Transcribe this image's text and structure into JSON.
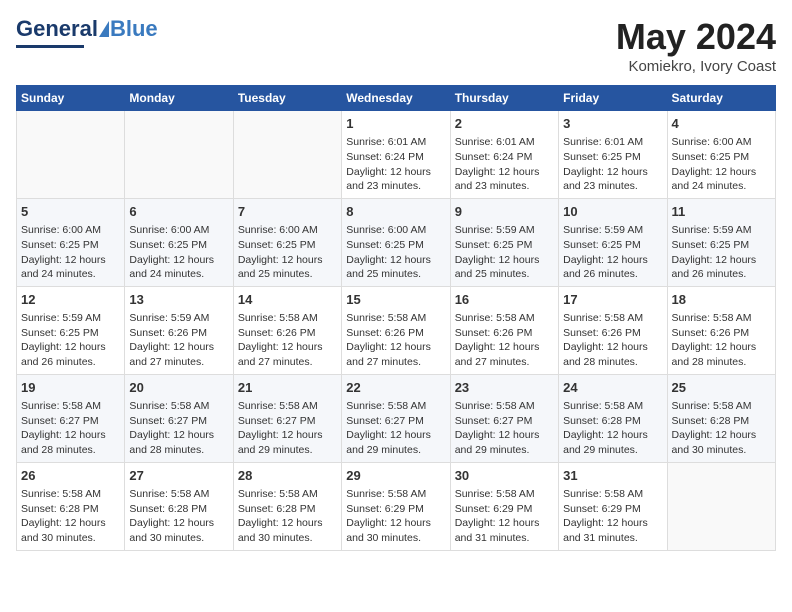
{
  "header": {
    "logo_general": "General",
    "logo_blue": "Blue",
    "title": "May 2024",
    "location": "Komiekro, Ivory Coast"
  },
  "days_of_week": [
    "Sunday",
    "Monday",
    "Tuesday",
    "Wednesday",
    "Thursday",
    "Friday",
    "Saturday"
  ],
  "weeks": [
    [
      {
        "day": "",
        "sunrise": "",
        "sunset": "",
        "daylight": ""
      },
      {
        "day": "",
        "sunrise": "",
        "sunset": "",
        "daylight": ""
      },
      {
        "day": "",
        "sunrise": "",
        "sunset": "",
        "daylight": ""
      },
      {
        "day": "1",
        "sunrise": "Sunrise: 6:01 AM",
        "sunset": "Sunset: 6:24 PM",
        "daylight": "Daylight: 12 hours and 23 minutes."
      },
      {
        "day": "2",
        "sunrise": "Sunrise: 6:01 AM",
        "sunset": "Sunset: 6:24 PM",
        "daylight": "Daylight: 12 hours and 23 minutes."
      },
      {
        "day": "3",
        "sunrise": "Sunrise: 6:01 AM",
        "sunset": "Sunset: 6:25 PM",
        "daylight": "Daylight: 12 hours and 23 minutes."
      },
      {
        "day": "4",
        "sunrise": "Sunrise: 6:00 AM",
        "sunset": "Sunset: 6:25 PM",
        "daylight": "Daylight: 12 hours and 24 minutes."
      }
    ],
    [
      {
        "day": "5",
        "sunrise": "Sunrise: 6:00 AM",
        "sunset": "Sunset: 6:25 PM",
        "daylight": "Daylight: 12 hours and 24 minutes."
      },
      {
        "day": "6",
        "sunrise": "Sunrise: 6:00 AM",
        "sunset": "Sunset: 6:25 PM",
        "daylight": "Daylight: 12 hours and 24 minutes."
      },
      {
        "day": "7",
        "sunrise": "Sunrise: 6:00 AM",
        "sunset": "Sunset: 6:25 PM",
        "daylight": "Daylight: 12 hours and 25 minutes."
      },
      {
        "day": "8",
        "sunrise": "Sunrise: 6:00 AM",
        "sunset": "Sunset: 6:25 PM",
        "daylight": "Daylight: 12 hours and 25 minutes."
      },
      {
        "day": "9",
        "sunrise": "Sunrise: 5:59 AM",
        "sunset": "Sunset: 6:25 PM",
        "daylight": "Daylight: 12 hours and 25 minutes."
      },
      {
        "day": "10",
        "sunrise": "Sunrise: 5:59 AM",
        "sunset": "Sunset: 6:25 PM",
        "daylight": "Daylight: 12 hours and 26 minutes."
      },
      {
        "day": "11",
        "sunrise": "Sunrise: 5:59 AM",
        "sunset": "Sunset: 6:25 PM",
        "daylight": "Daylight: 12 hours and 26 minutes."
      }
    ],
    [
      {
        "day": "12",
        "sunrise": "Sunrise: 5:59 AM",
        "sunset": "Sunset: 6:25 PM",
        "daylight": "Daylight: 12 hours and 26 minutes."
      },
      {
        "day": "13",
        "sunrise": "Sunrise: 5:59 AM",
        "sunset": "Sunset: 6:26 PM",
        "daylight": "Daylight: 12 hours and 27 minutes."
      },
      {
        "day": "14",
        "sunrise": "Sunrise: 5:58 AM",
        "sunset": "Sunset: 6:26 PM",
        "daylight": "Daylight: 12 hours and 27 minutes."
      },
      {
        "day": "15",
        "sunrise": "Sunrise: 5:58 AM",
        "sunset": "Sunset: 6:26 PM",
        "daylight": "Daylight: 12 hours and 27 minutes."
      },
      {
        "day": "16",
        "sunrise": "Sunrise: 5:58 AM",
        "sunset": "Sunset: 6:26 PM",
        "daylight": "Daylight: 12 hours and 27 minutes."
      },
      {
        "day": "17",
        "sunrise": "Sunrise: 5:58 AM",
        "sunset": "Sunset: 6:26 PM",
        "daylight": "Daylight: 12 hours and 28 minutes."
      },
      {
        "day": "18",
        "sunrise": "Sunrise: 5:58 AM",
        "sunset": "Sunset: 6:26 PM",
        "daylight": "Daylight: 12 hours and 28 minutes."
      }
    ],
    [
      {
        "day": "19",
        "sunrise": "Sunrise: 5:58 AM",
        "sunset": "Sunset: 6:27 PM",
        "daylight": "Daylight: 12 hours and 28 minutes."
      },
      {
        "day": "20",
        "sunrise": "Sunrise: 5:58 AM",
        "sunset": "Sunset: 6:27 PM",
        "daylight": "Daylight: 12 hours and 28 minutes."
      },
      {
        "day": "21",
        "sunrise": "Sunrise: 5:58 AM",
        "sunset": "Sunset: 6:27 PM",
        "daylight": "Daylight: 12 hours and 29 minutes."
      },
      {
        "day": "22",
        "sunrise": "Sunrise: 5:58 AM",
        "sunset": "Sunset: 6:27 PM",
        "daylight": "Daylight: 12 hours and 29 minutes."
      },
      {
        "day": "23",
        "sunrise": "Sunrise: 5:58 AM",
        "sunset": "Sunset: 6:27 PM",
        "daylight": "Daylight: 12 hours and 29 minutes."
      },
      {
        "day": "24",
        "sunrise": "Sunrise: 5:58 AM",
        "sunset": "Sunset: 6:28 PM",
        "daylight": "Daylight: 12 hours and 29 minutes."
      },
      {
        "day": "25",
        "sunrise": "Sunrise: 5:58 AM",
        "sunset": "Sunset: 6:28 PM",
        "daylight": "Daylight: 12 hours and 30 minutes."
      }
    ],
    [
      {
        "day": "26",
        "sunrise": "Sunrise: 5:58 AM",
        "sunset": "Sunset: 6:28 PM",
        "daylight": "Daylight: 12 hours and 30 minutes."
      },
      {
        "day": "27",
        "sunrise": "Sunrise: 5:58 AM",
        "sunset": "Sunset: 6:28 PM",
        "daylight": "Daylight: 12 hours and 30 minutes."
      },
      {
        "day": "28",
        "sunrise": "Sunrise: 5:58 AM",
        "sunset": "Sunset: 6:28 PM",
        "daylight": "Daylight: 12 hours and 30 minutes."
      },
      {
        "day": "29",
        "sunrise": "Sunrise: 5:58 AM",
        "sunset": "Sunset: 6:29 PM",
        "daylight": "Daylight: 12 hours and 30 minutes."
      },
      {
        "day": "30",
        "sunrise": "Sunrise: 5:58 AM",
        "sunset": "Sunset: 6:29 PM",
        "daylight": "Daylight: 12 hours and 31 minutes."
      },
      {
        "day": "31",
        "sunrise": "Sunrise: 5:58 AM",
        "sunset": "Sunset: 6:29 PM",
        "daylight": "Daylight: 12 hours and 31 minutes."
      },
      {
        "day": "",
        "sunrise": "",
        "sunset": "",
        "daylight": ""
      }
    ]
  ]
}
